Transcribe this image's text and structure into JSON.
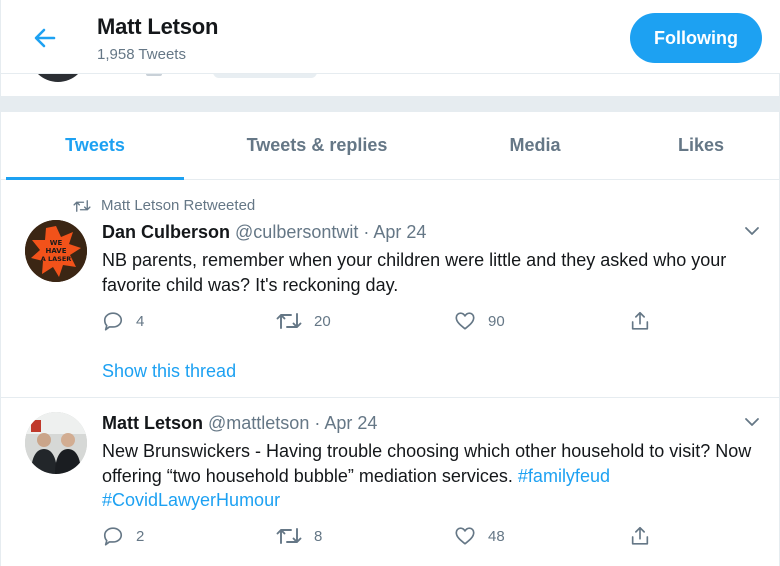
{
  "header": {
    "name": "Matt Letson",
    "tweet_count": "1,958 Tweets",
    "follow_label": "Following"
  },
  "tabs": [
    {
      "label": "Tweets",
      "active": true
    },
    {
      "label": "Tweets & replies",
      "active": false
    },
    {
      "label": "Media",
      "active": false
    },
    {
      "label": "Likes",
      "active": false
    }
  ],
  "tweets": [
    {
      "retweeted_by": "Matt Letson Retweeted",
      "name": "Dan Culberson",
      "handle": "@culbersontwit",
      "separator": "·",
      "date": "Apr 24",
      "text": "NB parents, remember when your children were little and they asked who your favorite child was? It's reckoning day.",
      "avatar_text": "WE HAVE A LASER",
      "replies": "4",
      "retweets": "20",
      "likes": "90",
      "show_thread": "Show this thread"
    },
    {
      "name": "Matt Letson",
      "handle": "@mattletson",
      "separator": "·",
      "date": "Apr 24",
      "text": "New Brunswickers - Having trouble choosing which other household to visit? Now offering “two household bubble” mediation services.",
      "hashtags": [
        "#familyfeud",
        "#CovidLawyerHumour"
      ],
      "replies": "2",
      "retweets": "8",
      "likes": "48"
    }
  ],
  "colors": {
    "accent": "#1da1f2",
    "text": "#14171a",
    "secondary": "#657786",
    "border": "#e6ecf0"
  },
  "icons": [
    "back-arrow-icon",
    "retweet-icon",
    "chevron-down-icon",
    "reply-icon",
    "like-icon",
    "share-icon"
  ]
}
